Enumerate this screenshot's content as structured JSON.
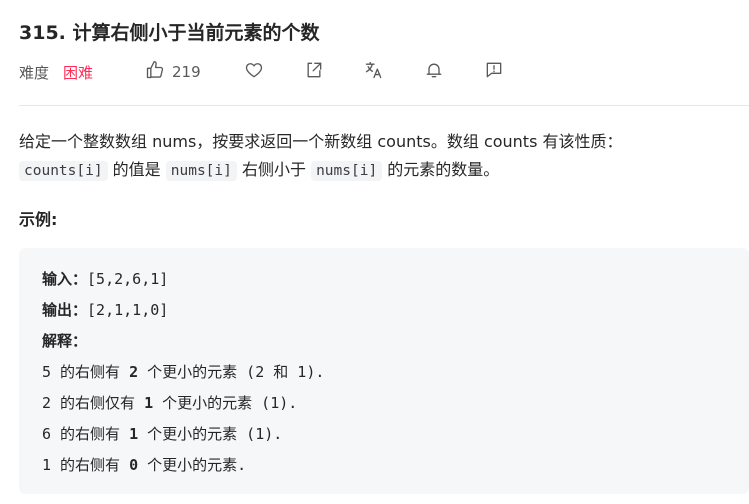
{
  "problem": {
    "title": "315. 计算右侧小于当前元素的个数",
    "difficulty_label": "难度",
    "difficulty": "困难",
    "likes": "219"
  },
  "icons": [
    "thumbs-up-icon",
    "heart-icon",
    "share-icon",
    "translate-icon",
    "bell-icon",
    "feedback-icon"
  ],
  "colors": {
    "difficulty_hard": "#ff2d55",
    "code_bg": "#f3f4f5",
    "example_bg": "#f6f7f8"
  },
  "description": {
    "p1": "给定一个整数数组 nums，按要求返回一个新数组 counts。数组 counts 有该性质：",
    "code1": "counts[i]",
    "t1": " 的值是 ",
    "code2": "nums[i]",
    "t2": " 右侧小于 ",
    "code3": "nums[i]",
    "t3": " 的元素的数量。"
  },
  "example": {
    "heading": "示例:",
    "input_label": "输入：",
    "input_value": "[5,2,6,1]",
    "output_label": "输出：",
    "output_value": "[2,1,1,0]",
    "explain_label": "解释：",
    "lines": [
      {
        "pre": "5 的右侧有 ",
        "num": "2",
        "post": " 个更小的元素 (2 和 1)."
      },
      {
        "pre": "2 的右侧仅有 ",
        "num": "1",
        "post": " 个更小的元素 (1)."
      },
      {
        "pre": "6 的右侧有 ",
        "num": "1",
        "post": " 个更小的元素 (1)."
      },
      {
        "pre": "1 的右侧有 ",
        "num": "0",
        "post": " 个更小的元素."
      }
    ]
  }
}
